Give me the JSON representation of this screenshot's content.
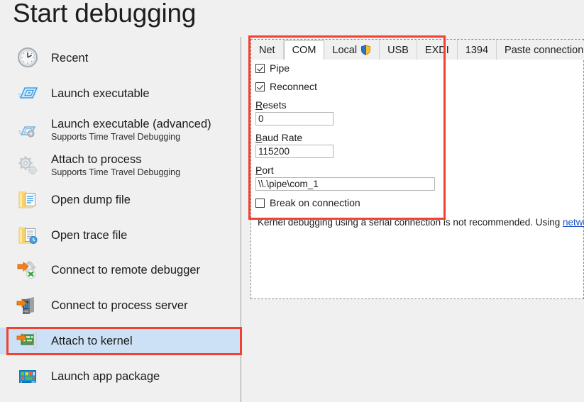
{
  "header": {
    "title": "Start debugging"
  },
  "sidebar": {
    "items": [
      {
        "label": "Recent",
        "sub": "",
        "icon": "clock-icon",
        "selected": false
      },
      {
        "label": "Launch executable",
        "sub": "",
        "icon": "executable-icon",
        "selected": false
      },
      {
        "label": "Launch executable (advanced)",
        "sub": "Supports Time Travel Debugging",
        "icon": "executable-advanced-icon",
        "selected": false
      },
      {
        "label": "Attach to process",
        "sub": "Supports Time Travel Debugging",
        "icon": "gears-icon",
        "selected": false
      },
      {
        "label": "Open dump file",
        "sub": "",
        "icon": "folder-document-icon",
        "selected": false
      },
      {
        "label": "Open trace file",
        "sub": "",
        "icon": "folder-trace-icon",
        "selected": false
      },
      {
        "label": "Connect to remote debugger",
        "sub": "",
        "icon": "remote-debugger-icon",
        "selected": false
      },
      {
        "label": "Connect to process server",
        "sub": "",
        "icon": "server-icon",
        "selected": false
      },
      {
        "label": "Attach to kernel",
        "sub": "",
        "icon": "kernel-card-icon",
        "selected": true
      },
      {
        "label": "Launch app package",
        "sub": "",
        "icon": "app-package-icon",
        "selected": false
      }
    ]
  },
  "tabs": [
    {
      "label": "Net",
      "active": false,
      "icon": ""
    },
    {
      "label": "COM",
      "active": true,
      "icon": ""
    },
    {
      "label": "Local",
      "active": false,
      "icon": "uac-shield-icon"
    },
    {
      "label": "USB",
      "active": false,
      "icon": ""
    },
    {
      "label": "EXDI",
      "active": false,
      "icon": ""
    },
    {
      "label": "1394",
      "active": false,
      "icon": ""
    },
    {
      "label": "Paste connection string",
      "active": false,
      "icon": ""
    }
  ],
  "form": {
    "pipe": {
      "label": "Pipe",
      "checked": true
    },
    "reconnect": {
      "label": "Reconnect",
      "checked": true
    },
    "resets": {
      "label_accel": "R",
      "label_rest": "esets",
      "value": "0"
    },
    "baud_rate": {
      "label_accel": "B",
      "label_rest": "aud Rate",
      "value": "115200"
    },
    "port": {
      "label_accel": "P",
      "label_rest": "ort",
      "value": "\\\\.\\pipe\\com_1"
    },
    "break_on_connection": {
      "label": "Break on connection",
      "checked": false
    }
  },
  "status": {
    "text": "Kernel debugging using a serial connection is not recommended. Using ",
    "link": "network"
  },
  "colors": {
    "accent_selection": "#cce1f5",
    "annotation": "#f4402f",
    "link": "#1a52c4",
    "panel_background": "#f0f0f0"
  }
}
